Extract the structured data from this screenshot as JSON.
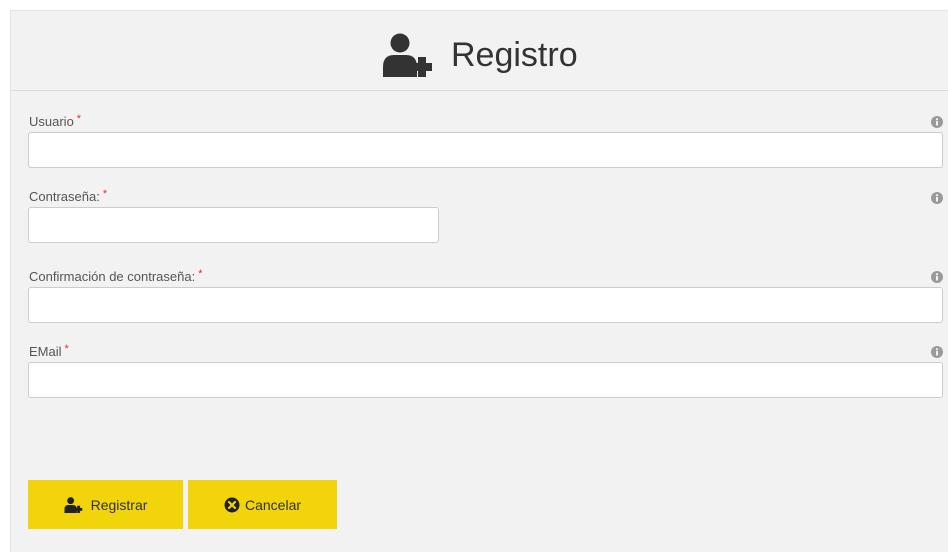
{
  "header": {
    "icon": "user-plus-icon",
    "title": "Registro"
  },
  "form": {
    "required_marker": "*",
    "info_icon": "info-circle-icon",
    "fields": [
      {
        "label": "Usuario",
        "value": "",
        "placeholder": ""
      },
      {
        "label": "Contraseña:",
        "value": "",
        "placeholder": ""
      },
      {
        "label": "Confirmación de contraseña:",
        "value": "",
        "placeholder": ""
      },
      {
        "label": "EMail",
        "value": "",
        "placeholder": ""
      }
    ]
  },
  "buttons": {
    "register": {
      "label": "Registrar",
      "icon": "user-plus-icon"
    },
    "cancel": {
      "label": "Cancelar",
      "icon": "times-circle-icon"
    }
  },
  "colors": {
    "panel_background": "#f2f2f2",
    "button_background": "#f2d40d",
    "required_marker": "#e03030",
    "title_text": "#333333"
  }
}
